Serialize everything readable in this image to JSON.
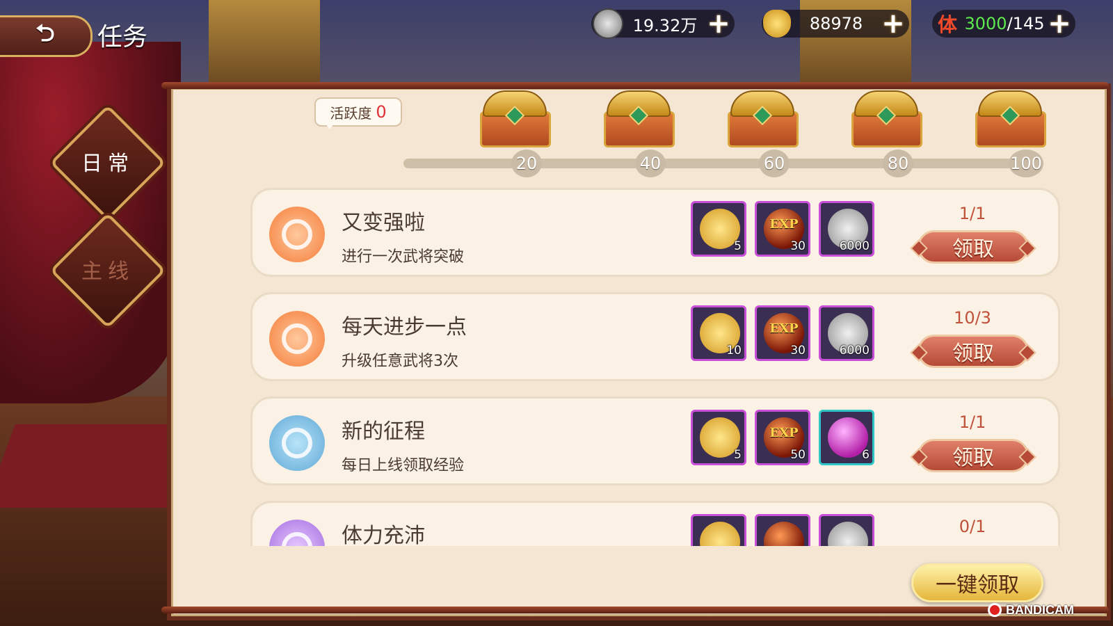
{
  "header": {
    "back_icon": "back-arrow-icon",
    "title": "任务",
    "resources": [
      {
        "id": "silver",
        "icon": "silver-coin-icon",
        "value": "19.32万"
      },
      {
        "id": "gold",
        "icon": "gold-ingot-icon",
        "value": "88978"
      },
      {
        "id": "stamina",
        "icon": "stamina-icon",
        "icon_text": "体",
        "current": "3000",
        "separator": "/",
        "max": "145"
      }
    ]
  },
  "tabs": [
    {
      "label": "日常",
      "active": true
    },
    {
      "label": "主线",
      "active": false
    }
  ],
  "activity": {
    "label": "活跃度",
    "value": "0",
    "milestones": [
      "20",
      "40",
      "60",
      "80",
      "100"
    ]
  },
  "tasks": [
    {
      "title": "又变强啦",
      "desc": "进行一次武将突破",
      "icon": "breakthrough-icon",
      "icon_color": "orange",
      "rewards": [
        {
          "type": "gold-star",
          "qty": "5"
        },
        {
          "type": "exp",
          "label": "EXP",
          "qty": "30"
        },
        {
          "type": "silver-coin",
          "qty": "6000"
        }
      ],
      "progress": "1/1",
      "button": "领取"
    },
    {
      "title": "每天进步一点",
      "desc": "升级任意武将3次",
      "icon": "breakthrough-icon",
      "icon_color": "orange",
      "rewards": [
        {
          "type": "gold-star",
          "qty": "10"
        },
        {
          "type": "exp",
          "label": "EXP",
          "qty": "30"
        },
        {
          "type": "silver-coin",
          "qty": "6000"
        }
      ],
      "progress": "10/3",
      "button": "领取"
    },
    {
      "title": "新的征程",
      "desc": "每日上线领取经验",
      "icon": "user-icon",
      "icon_color": "blue",
      "rewards": [
        {
          "type": "gold-star",
          "qty": "5"
        },
        {
          "type": "exp",
          "label": "EXP",
          "qty": "50"
        },
        {
          "type": "pink-orb",
          "qty": "6"
        }
      ],
      "progress": "1/1",
      "button": "领取"
    },
    {
      "title": "体力充沛",
      "desc": "",
      "icon": "stamina-task-icon",
      "icon_color": "purple",
      "rewards": [
        {
          "type": "gold-star",
          "qty": ""
        },
        {
          "type": "exp",
          "label": "",
          "qty": ""
        },
        {
          "type": "silver-coin",
          "qty": ""
        }
      ],
      "progress": "0/1",
      "button": ""
    }
  ],
  "claim_all": "一键领取",
  "watermark": "BANDICAM",
  "colors": {
    "panel_bg": "#f4e6d2",
    "claim_button": "#c9583f",
    "progress_text": "#c0513a",
    "stamina_current": "#5eea4c",
    "activity_value": "#e0313a"
  }
}
